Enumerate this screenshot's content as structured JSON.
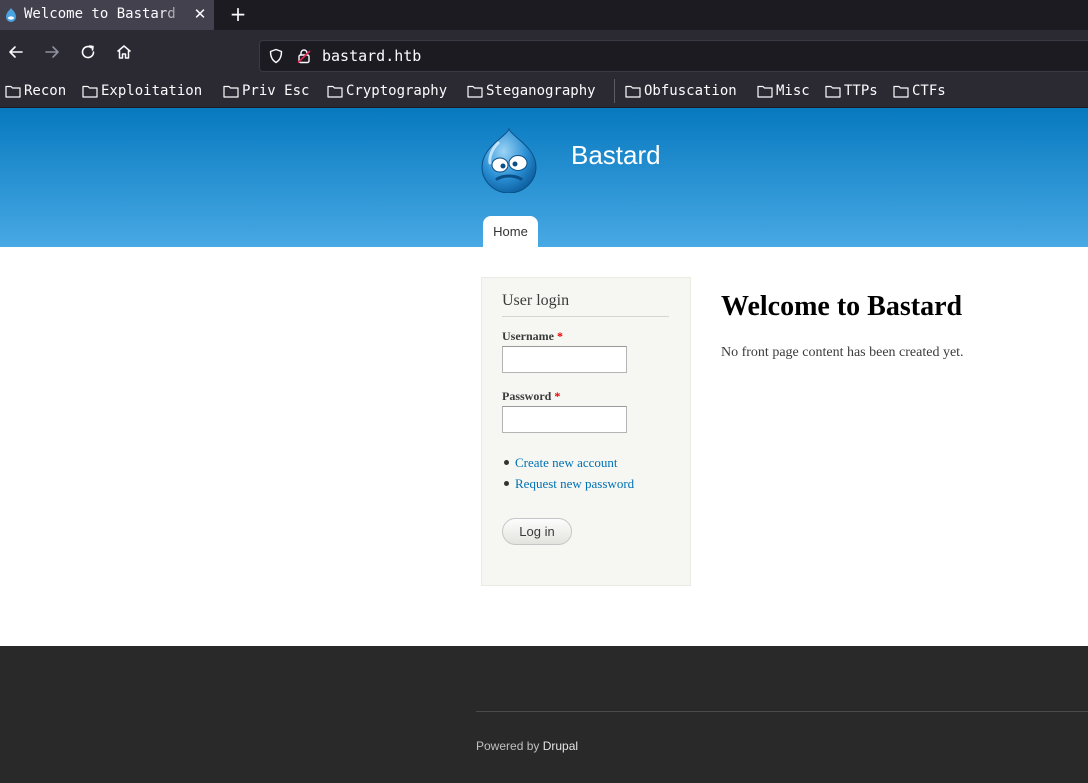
{
  "browser": {
    "tab_title": "Welcome to Bastard",
    "url": "bastard.htb",
    "bookmarks": [
      "Recon",
      "Exploitation",
      "Priv Esc",
      "Cryptography",
      "Steganography",
      "Obfuscation",
      "Misc",
      "TTPs",
      "CTFs"
    ]
  },
  "site": {
    "name": "Bastard",
    "nav": {
      "home": "Home"
    }
  },
  "login": {
    "title": "User login",
    "username_label": "Username",
    "password_label": "Password",
    "required_marker": "*",
    "links": [
      "Create new account",
      "Request new password"
    ],
    "submit": "Log in"
  },
  "main": {
    "title": "Welcome to Bastard",
    "text": "No front page content has been created yet."
  },
  "footer": {
    "powered_prefix": "Powered by",
    "powered_link": "Drupal"
  },
  "colors": {
    "header_top": "#0779bf",
    "header_bottom": "#48a9e4",
    "link": "#0071b3",
    "footer_bg": "#292929"
  },
  "icons": [
    "drupal-favicon",
    "close-icon",
    "plus-icon",
    "back-arrow-icon",
    "forward-arrow-icon",
    "reload-icon",
    "home-icon",
    "shield-icon",
    "lock-icon",
    "folder-icon",
    "drupal-logo"
  ]
}
